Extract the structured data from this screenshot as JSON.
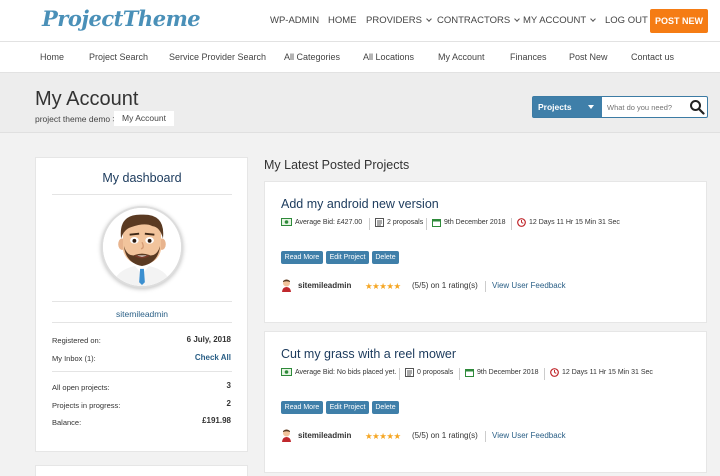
{
  "header": {
    "logo": "ProjectTheme",
    "nav": [
      {
        "label": "WP-ADMIN",
        "dropdown": false
      },
      {
        "label": "HOME",
        "dropdown": false
      },
      {
        "label": "PROVIDERS",
        "dropdown": true
      },
      {
        "label": "CONTRACTORS",
        "dropdown": true
      },
      {
        "label": "MY ACCOUNT",
        "dropdown": true
      },
      {
        "label": "LOG OUT",
        "dropdown": false
      }
    ],
    "post_new": "POST NEW"
  },
  "subnav": [
    "Home",
    "Project Search",
    "Service Provider Search",
    "All Categories",
    "All Locations",
    "My Account",
    "Finances",
    "Post New",
    "Contact us"
  ],
  "page": {
    "title": "My Account",
    "breadcrumb_root": "project theme demo >",
    "breadcrumb_current": "My Account"
  },
  "search": {
    "select_label": "Projects",
    "placeholder": "What do you need?"
  },
  "dashboard": {
    "title": "My dashboard",
    "username": "sitemileadmin",
    "rows": [
      {
        "label": "Registered on:",
        "value": "6 July, 2018",
        "link": false
      },
      {
        "label": "My Inbox (1):",
        "value": "Check All",
        "link": true
      },
      {
        "label": "All open projects:",
        "value": "3",
        "link": false
      },
      {
        "label": "Projects in progress:",
        "value": "2",
        "link": false
      },
      {
        "label": "Balance:",
        "value": "£191.98",
        "link": false
      }
    ]
  },
  "projects_section_title": "My Latest Posted Projects",
  "projects": [
    {
      "title": "Add my android new version",
      "average_bid": "Average Bid: £427.00",
      "proposals": "2 proposals",
      "date": "9th December 2018",
      "time_left": "12 Days 11 Hr 15 Min 31 Sec",
      "buttons": [
        "Read More",
        "Edit Project",
        "Delete"
      ],
      "owner": "sitemileadmin",
      "stars": "★★★★★",
      "rating_text": "(5/5) on 1 rating(s)",
      "feedback_link": "View User Feedback"
    },
    {
      "title": "Cut my grass with a reel mower",
      "average_bid": "Average Bid: No bids placed yet.",
      "proposals": "0 proposals",
      "date": "9th December 2018",
      "time_left": "12 Days 11 Hr 15 Min 31 Sec",
      "buttons": [
        "Read More",
        "Edit Project",
        "Delete"
      ],
      "owner": "sitemileadmin",
      "stars": "★★★★★",
      "rating_text": "(5/5) on 1 rating(s)",
      "feedback_link": "View User Feedback"
    }
  ],
  "colors": {
    "accent_orange": "#f57c14",
    "primary_blue": "#3f7fa9",
    "title_navy": "#1b3a5c",
    "star_gold": "#f5a623"
  }
}
